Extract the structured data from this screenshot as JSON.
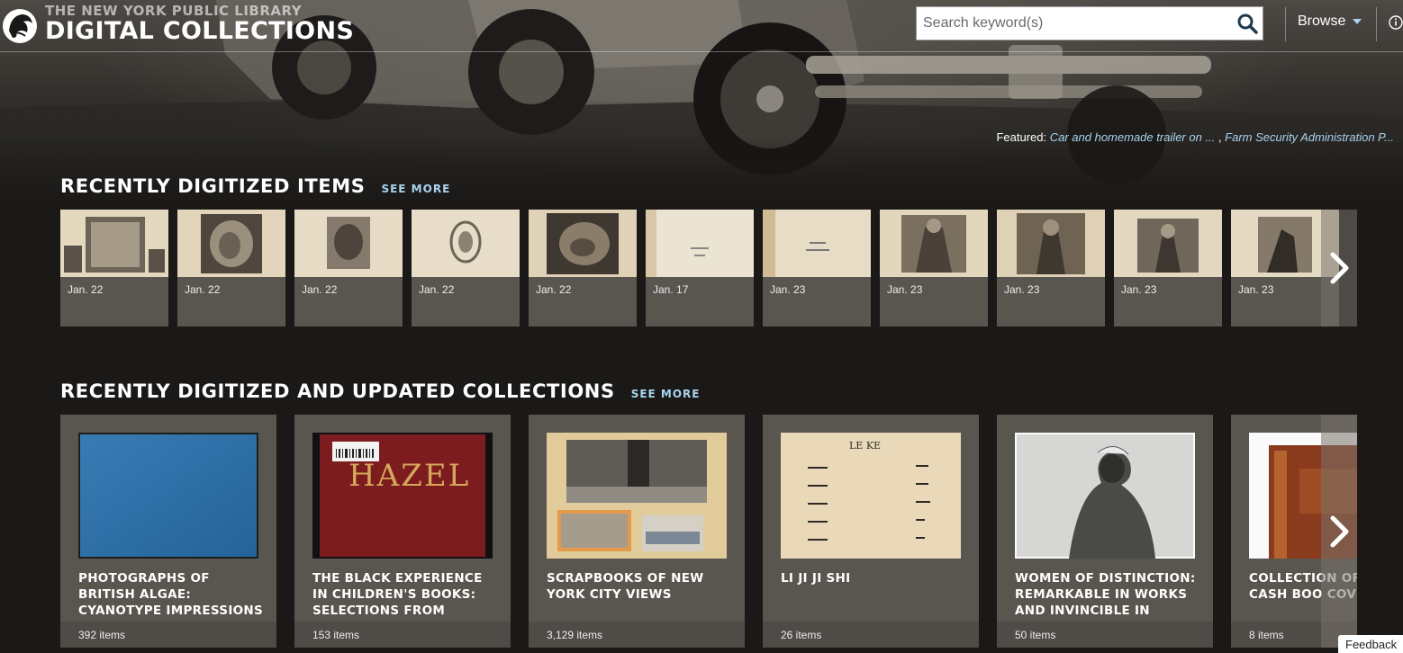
{
  "header": {
    "logo_sub": "THE NEW YORK PUBLIC LIBRARY",
    "logo_main": "DIGITAL COLLECTIONS",
    "search_placeholder": "Search keyword(s)",
    "browse_label": "Browse",
    "featured_label": "Featured:",
    "featured_link_1": "Car and homemade trailer on ...",
    "featured_sep": ",",
    "featured_link_2": "Farm Security Administration P..."
  },
  "recent_items": {
    "title": "RECENTLY DIGITIZED ITEMS",
    "see_more": "SEE MORE",
    "items": [
      {
        "date": "Jan. 22"
      },
      {
        "date": "Jan. 22"
      },
      {
        "date": "Jan. 22"
      },
      {
        "date": "Jan. 22"
      },
      {
        "date": "Jan. 22"
      },
      {
        "date": "Jan. 17"
      },
      {
        "date": "Jan. 23"
      },
      {
        "date": "Jan. 23"
      },
      {
        "date": "Jan. 23"
      },
      {
        "date": "Jan. 23"
      },
      {
        "date": "Jan. 23"
      }
    ]
  },
  "collections": {
    "title": "RECENTLY DIGITIZED AND UPDATED COLLECTIONS",
    "see_more": "SEE MORE",
    "items": [
      {
        "title": "PHOTOGRAPHS OF BRITISH ALGAE: CYANOTYPE IMPRESSIONS",
        "count": "392 items"
      },
      {
        "title": "THE BLACK EXPERIENCE IN CHILDREN'S BOOKS: SELECTIONS FROM",
        "count": "153 items",
        "cover_text": "HAZEL"
      },
      {
        "title": "SCRAPBOOKS OF NEW YORK CITY VIEWS",
        "count": "3,129 items"
      },
      {
        "title": "LI JI JI SHI",
        "count": "26 items",
        "page_heading": "LE KE"
      },
      {
        "title": "WOMEN OF DISTINCTION: REMARKABLE IN WORKS AND INVINCIBLE IN",
        "count": "50 items"
      },
      {
        "title": "COLLECTION OF AND CASH BOO COVERING THE",
        "count": "8 items"
      }
    ]
  },
  "feedback_label": "Feedback",
  "colors": {
    "accent_link": "#a9d3ef",
    "card_bg": "#59554f",
    "page_bg": "#1b1917"
  }
}
